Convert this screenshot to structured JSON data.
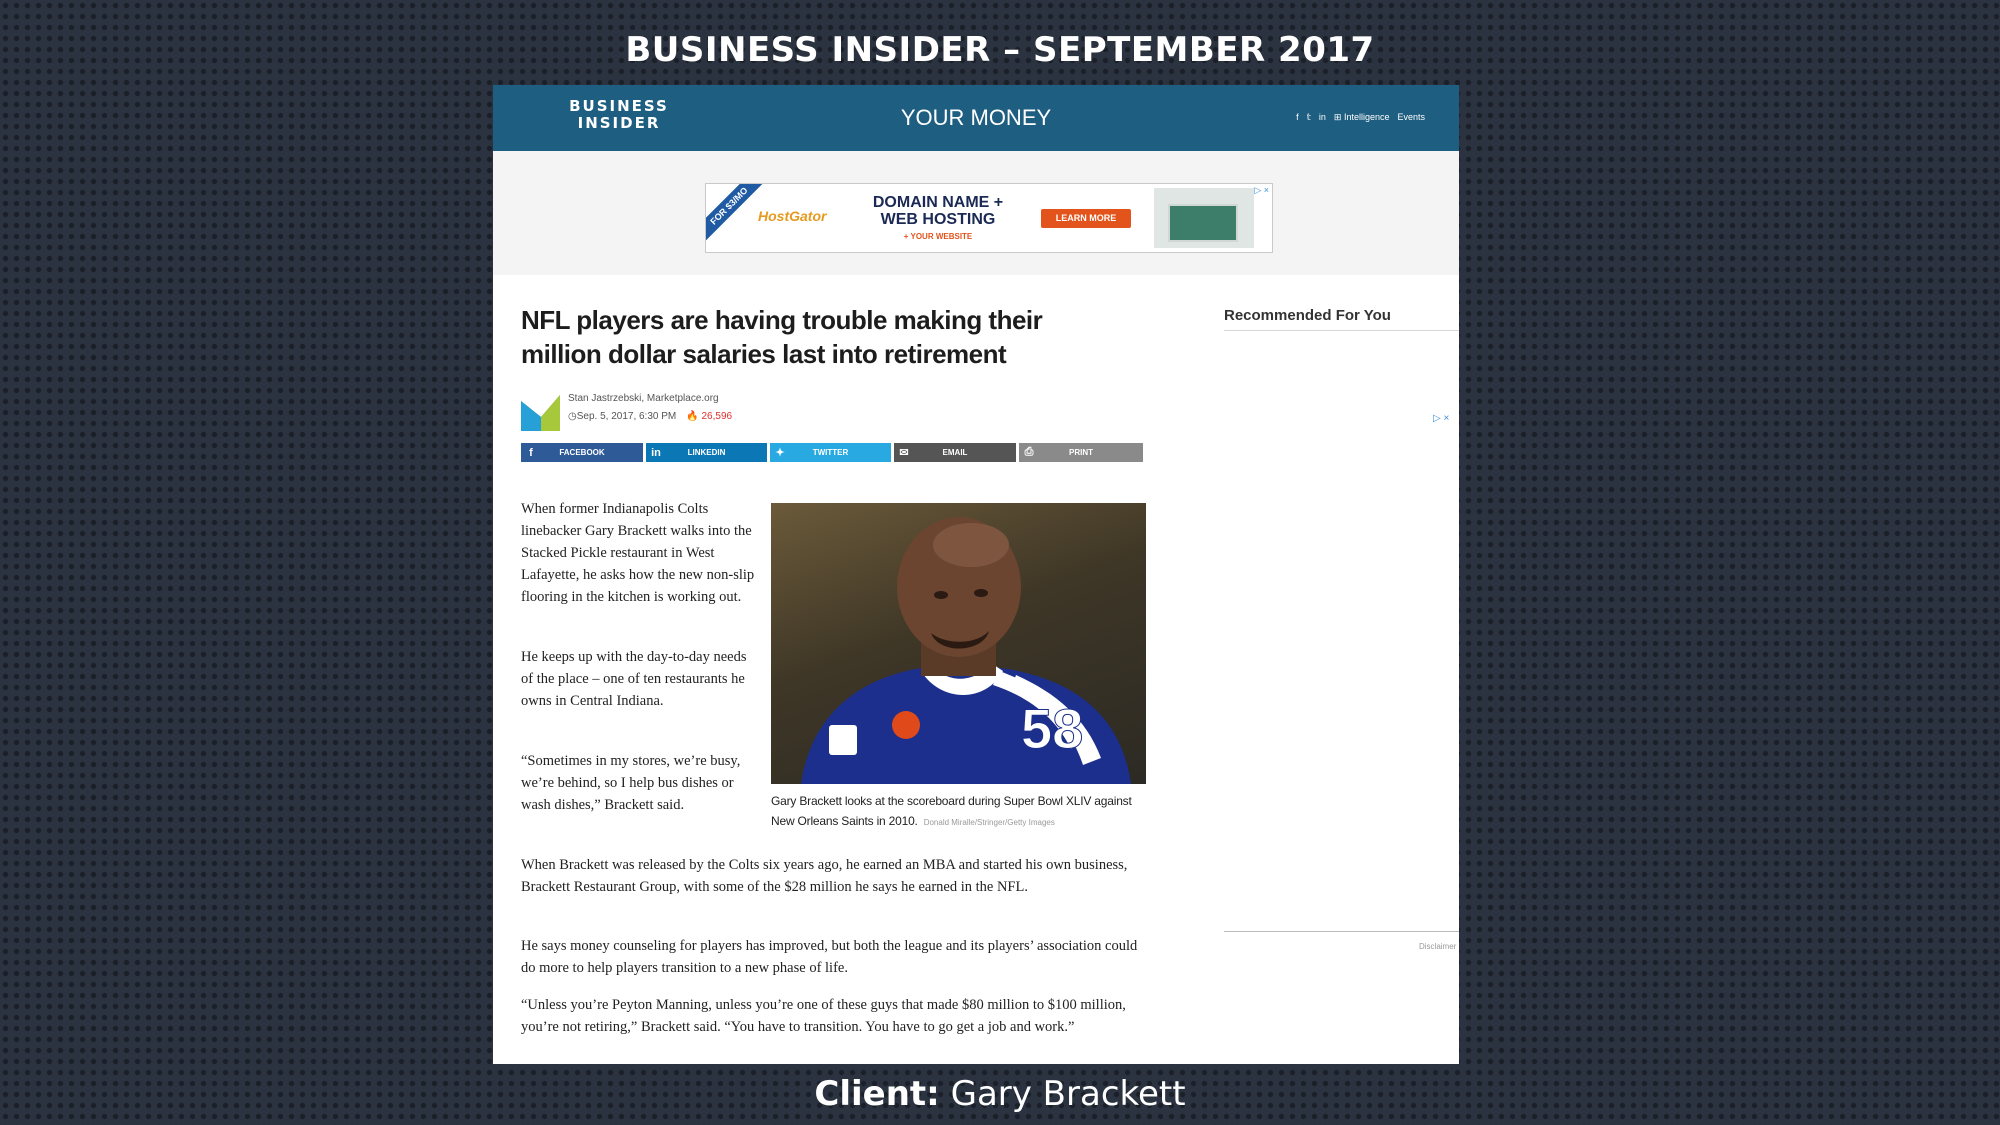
{
  "slide": {
    "title": "BUSINESS INSIDER – SEPTEMBER 2017",
    "client_label": "Client:",
    "client_name": "Gary Brackett"
  },
  "site": {
    "logo": "BUSINESS INSIDER",
    "section": "YOUR MONEY",
    "nav": [
      "f",
      "𝕥",
      "in",
      "⊞ Intelligence",
      "Events"
    ]
  },
  "ad": {
    "ribbon": "FOR $3/MO",
    "brand": "HostGator",
    "headline": "DOMAIN NAME + WEB HOSTING",
    "sub": "+ YOUR WEBSITE",
    "cta": "LEARN MORE",
    "close": "▷ ×"
  },
  "article": {
    "title": "NFL players are having trouble making their million dollar salaries last into retirement",
    "author": "Stan Jastrzebski, Marketplace.org",
    "date": "◷Sep. 5, 2017, 6:30 PM",
    "views": "🔥 26,596",
    "share": {
      "facebook": "FACEBOOK",
      "linkedin": "LINKEDIN",
      "twitter": "TWITTER",
      "email": "EMAIL",
      "print": "PRINT"
    },
    "paragraphs": [
      "When former Indianapolis Colts linebacker Gary Brackett walks into the Stacked Pickle restaurant in West Lafayette, he asks how the new non-slip flooring in the kitchen is working out.",
      "He keeps up with the day-to-day needs of the place – one of ten restaurants he owns in Central Indiana.",
      "“Sometimes in my stores, we’re busy, we’re behind, so I help bus dishes or wash dishes,” Brackett said.",
      "When Brackett was released by the Colts six years ago, he earned an MBA and started his own business, Brackett Restaurant Group, with some of the $28 million he says he earned in the NFL.",
      "He says money counseling for players has improved, but both the league and its players’ association could do more to help players transition to a new phase of life.",
      "“Unless you’re Peyton Manning, unless you’re one of these guys that made $80 million to $100 million, you’re not retiring,” Brackett said. “You have to transition. You have to go get a job and work.”"
    ],
    "photo": {
      "jersey_number": "58",
      "caption": "Gary Brackett looks at the scoreboard during Super Bowl XLIV against New Orleans Saints in 2010.",
      "credit": "Donald Miralle/Stringer/Getty Images"
    }
  },
  "sidebar": {
    "recommended_title": "Recommended For You",
    "ad_choices": "▷ ×",
    "disclaimer": "Disclaimer"
  }
}
